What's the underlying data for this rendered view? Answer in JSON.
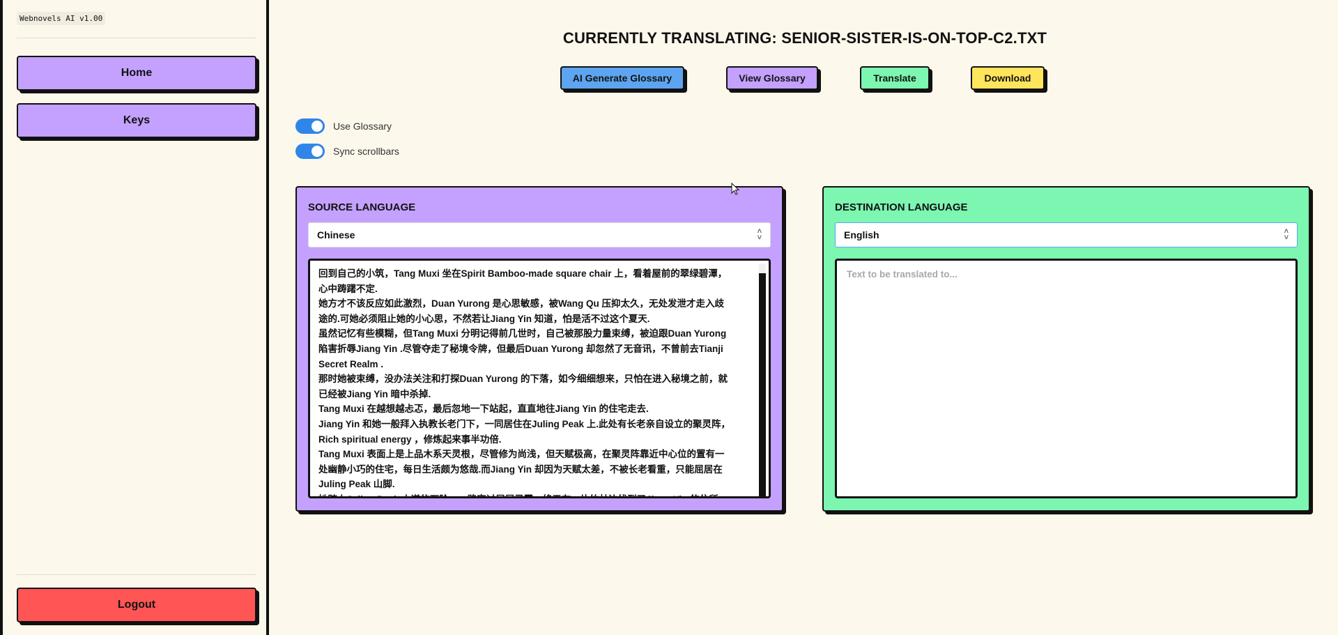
{
  "sidebar": {
    "brand": "Webnovels AI v1.00",
    "home_label": "Home",
    "keys_label": "Keys",
    "logout_label": "Logout"
  },
  "main": {
    "title": "CURRENTLY TRANSLATING: SENIOR-SISTER-IS-ON-TOP-C2.TXT",
    "actions": {
      "generate_glossary": "AI Generate Glossary",
      "view_glossary": "View Glossary",
      "translate": "Translate",
      "download": "Download"
    },
    "toggles": {
      "use_glossary": "Use Glossary",
      "sync_scrollbars": "Sync scrollbars"
    },
    "source": {
      "heading": "SOURCE LANGUAGE",
      "language": "Chinese",
      "text": "回到自己的小筑，Tang Muxi 坐在Spirit Bamboo-made square chair 上，看着屋前的翠绿碧潭，\n心中踌躇不定.\n她方才不该反应如此激烈，Duan Yurong 是心思敏感，被Wang Qu 压抑太久，无处发泄才走入歧\n途的.可她必须阻止她的小心思，不然若让Jiang Yin 知道，怕是活不过这个夏天.\n虽然记忆有些模糊，但Tang Muxi 分明记得前几世时，自己被那股力量束缚，被迫跟Duan Yurong\n陷害折辱Jiang Yin .尽管夺走了秘境令牌，但最后Duan Yurong 却忽然了无音讯，不曾前去Tianji\nSecret Realm .\n那时她被束缚，没办法关注和打探Duan Yurong 的下落，如今细细想来，只怕在进入秘境之前，就\n已经被Jiang Yin 暗中杀掉.\nTang Muxi 在越想越忐忑，最后忽地一下站起，直直地往Jiang Yin 的住宅走去.\nJiang Yin 和她一般拜入执教长老门下，一同居住在Juling Peak 上.此处有长老亲自设立的聚灵阵，\nRich spiritual energy ，修炼起来事半功倍.\nTang Muxi 表面上是上品木系天灵根，尽管修为尚浅，但天赋极高，在聚灵阵靠近中心位的置有一\n处幽静小巧的住宅，每日生活颇为悠哉.而Jiang Yin 却因为天赋太差，不被长老看重，只能屈居在\nJuling Peak 山脚.\n她踏上Juling Peak 山道的石阶，一路穿过层层灵雾，终于在一片竹林边找到了Jiang Yin 的住所."
    },
    "destination": {
      "heading": "DESTINATION LANGUAGE",
      "language": "English",
      "placeholder": "Text to be translated to..."
    }
  },
  "colors": {
    "background": "#fdf8ec",
    "purple": "#c4a1fe",
    "green": "#7cf6b0",
    "blue": "#5da5f0",
    "yellow": "#ffe55c",
    "red": "#ff5555",
    "toggle": "#2f86e8"
  }
}
